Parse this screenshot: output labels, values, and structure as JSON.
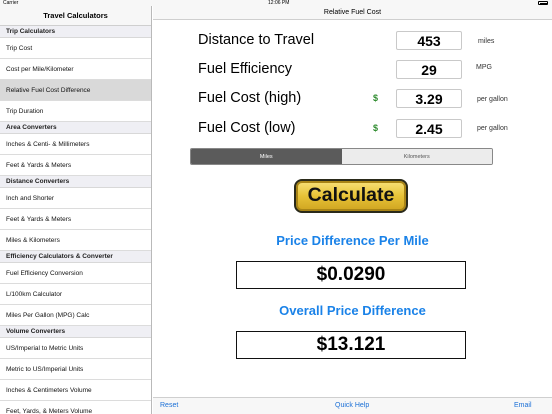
{
  "status": {
    "carrier": "Carrier",
    "time": "12:06 PM"
  },
  "sidebar": {
    "title": "Travel Calculators",
    "sections": [
      {
        "header": "Trip Calculators",
        "items": [
          "Trip Cost",
          "Cost per Mile/Kilometer",
          "Relative Fuel Cost Difference",
          "Trip Duration"
        ]
      },
      {
        "header": "Area Converters",
        "items": [
          "Inches & Centi- & Millimeters",
          "Feet & Yards & Meters"
        ]
      },
      {
        "header": "Distance Converters",
        "items": [
          "Inch and Shorter",
          "Feet & Yards & Meters",
          "Miles & Kilometers"
        ]
      },
      {
        "header": "Efficiency Calculators & Converter",
        "items": [
          "Fuel Efficiency Conversion",
          "L/100km Calculator",
          "Miles Per Gallon (MPG) Calc"
        ]
      },
      {
        "header": "Volume Converters",
        "items": [
          "US/Imperial to Metric Units",
          "Metric to US/Imperial Units",
          "Inches & Centimeters Volume",
          "Feet, Yards, & Meters Volume"
        ]
      }
    ],
    "selected": "Relative Fuel Cost Difference"
  },
  "main": {
    "title": "Relative Fuel Cost",
    "rows": {
      "distance": {
        "label": "Distance to Travel",
        "value": "453",
        "unit": "miles"
      },
      "efficiency": {
        "label": "Fuel Efficiency",
        "value": "29",
        "unit": "MPG"
      },
      "cost_high": {
        "label": "Fuel Cost (high)",
        "currency": "$",
        "value": "3.29",
        "unit": "per gallon"
      },
      "cost_low": {
        "label": "Fuel Cost (low)",
        "currency": "$",
        "value": "2.45",
        "unit": "per gallon"
      }
    },
    "segment": {
      "options": [
        "Miles",
        "Kilometers"
      ],
      "selected": "Miles"
    },
    "calculate_label": "Calculate",
    "result_per_mile": {
      "title": "Price Difference Per Mile",
      "value": "$0.0290"
    },
    "result_overall": {
      "title": "Overall Price Difference",
      "value": "$13.121"
    }
  },
  "toolbar": {
    "reset": "Reset",
    "help": "Quick Help",
    "email": "Email"
  },
  "colors": {
    "accent": "#1a82e8",
    "currency": "#2e8b2e",
    "button_gold": "#e7c237"
  }
}
